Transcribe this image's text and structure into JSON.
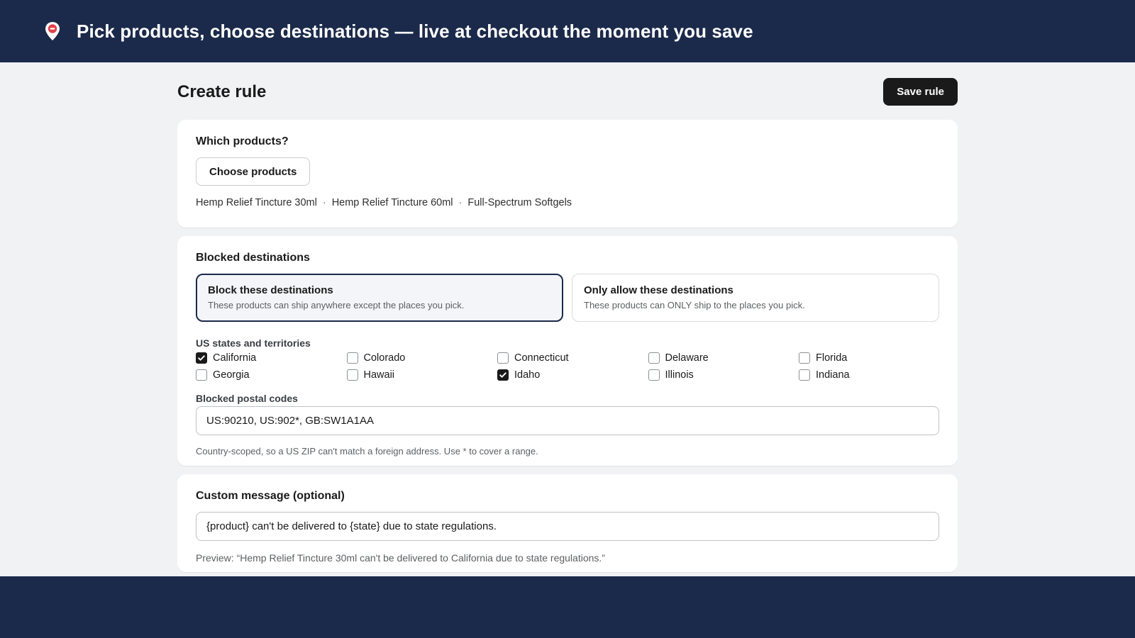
{
  "banner": {
    "icon": "location-pin-blocked-icon",
    "title": "Pick products, choose destinations — live at checkout the moment you save"
  },
  "page": {
    "title": "Create rule",
    "save_label": "Save rule"
  },
  "products": {
    "title": "Which products?",
    "choose_label": "Choose products",
    "items": [
      "Hemp Relief Tincture 30ml",
      "Hemp Relief Tincture 60ml",
      "Full-Spectrum Softgels"
    ],
    "separator": "·"
  },
  "destinations": {
    "title": "Blocked destinations",
    "modes": [
      {
        "title": "Block these destinations",
        "description": "These products can ship anywhere except the places you pick.",
        "selected": true
      },
      {
        "title": "Only allow these destinations",
        "description": "These products can ONLY ship to the places you pick.",
        "selected": false
      }
    ],
    "states_label": "US states and territories",
    "states": [
      {
        "name": "California",
        "checked": true
      },
      {
        "name": "Colorado",
        "checked": false
      },
      {
        "name": "Connecticut",
        "checked": false
      },
      {
        "name": "Delaware",
        "checked": false
      },
      {
        "name": "Florida",
        "checked": false
      },
      {
        "name": "Georgia",
        "checked": false
      },
      {
        "name": "Hawaii",
        "checked": false
      },
      {
        "name": "Idaho",
        "checked": true
      },
      {
        "name": "Illinois",
        "checked": false
      },
      {
        "name": "Indiana",
        "checked": false
      }
    ],
    "postal_label": "Blocked postal codes",
    "postal_value": "US:90210, US:902*, GB:SW1A1AA",
    "postal_help": "Country-scoped, so a US ZIP can't match a foreign address. Use * to cover a range."
  },
  "message": {
    "title": "Custom message (optional)",
    "value": "{product} can't be delivered to {state} due to state regulations.",
    "preview": "Preview: “Hemp Relief Tincture 30ml can't be delivered to California due to state regulations.”"
  },
  "colors": {
    "banner_bg": "#1b2a4a",
    "app_bg": "#f1f2f4",
    "primary_button": "#1a1a1a",
    "pin_red": "#e0424a"
  }
}
